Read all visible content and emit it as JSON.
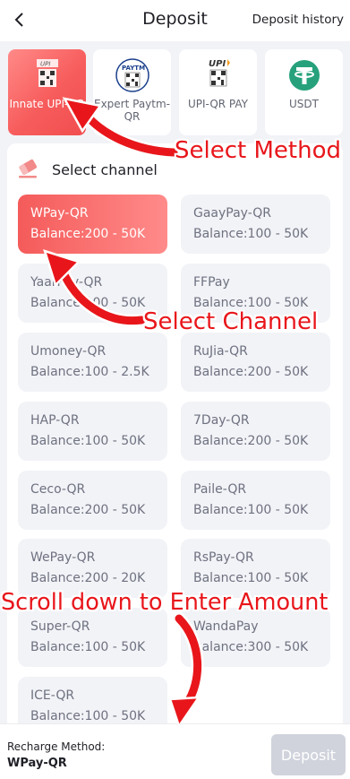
{
  "header": {
    "title": "Deposit",
    "history_label": "Deposit history"
  },
  "methods": [
    {
      "label": "Innate UPI-QR",
      "icon": "upi-qr-icon",
      "active": true
    },
    {
      "label": "Expert Paytm-QR",
      "icon": "paytm-qr-icon",
      "active": false
    },
    {
      "label": "UPI-QR PAY",
      "icon": "upi-pay-icon",
      "active": false
    },
    {
      "label": "USDT",
      "icon": "tether-icon",
      "active": false
    }
  ],
  "channel_section": {
    "title": "Select channel",
    "icon": "eraser-icon"
  },
  "channels": [
    {
      "name": "WPay-QR",
      "balance": "Balance:200 - 50K",
      "selected": true
    },
    {
      "name": "GaayPay-QR",
      "balance": "Balance:100 - 50K",
      "selected": false
    },
    {
      "name": "YaarPay-QR",
      "balance": "Balance:100 - 50K",
      "selected": false
    },
    {
      "name": "FFPay",
      "balance": "Balance:100 - 50K",
      "selected": false
    },
    {
      "name": "Umoney-QR",
      "balance": "Balance:100 - 2.5K",
      "selected": false
    },
    {
      "name": "RuJia-QR",
      "balance": "Balance:200 - 50K",
      "selected": false
    },
    {
      "name": "HAP-QR",
      "balance": "Balance:100 - 50K",
      "selected": false
    },
    {
      "name": "7Day-QR",
      "balance": "Balance:200 - 50K",
      "selected": false
    },
    {
      "name": "Ceco-QR",
      "balance": "Balance:200 - 50K",
      "selected": false
    },
    {
      "name": "Paile-QR",
      "balance": "Balance:100 - 50K",
      "selected": false
    },
    {
      "name": "WePay-QR",
      "balance": "Balance:200 - 20K",
      "selected": false
    },
    {
      "name": "RsPay-QR",
      "balance": "Balance:100 - 50K",
      "selected": false
    },
    {
      "name": "Super-QR",
      "balance": "Balance:100 - 50K",
      "selected": false
    },
    {
      "name": "WandaPay",
      "balance": "Balance:300 - 50K",
      "selected": false
    },
    {
      "name": "ICE-QR",
      "balance": "Balance:100 - 50K",
      "selected": false
    }
  ],
  "annotations": {
    "select_method": "Select Method",
    "select_channel": "Select Channel",
    "scroll_down": "Scroll down to Enter Amount"
  },
  "footer": {
    "recharge_label": "Recharge Method:",
    "recharge_value": "WPay-QR",
    "deposit_label": "Deposit"
  },
  "colors": {
    "accent": "#f45b5a",
    "annotation": "#e8161b",
    "disabled_button": "#d0d3dc"
  }
}
